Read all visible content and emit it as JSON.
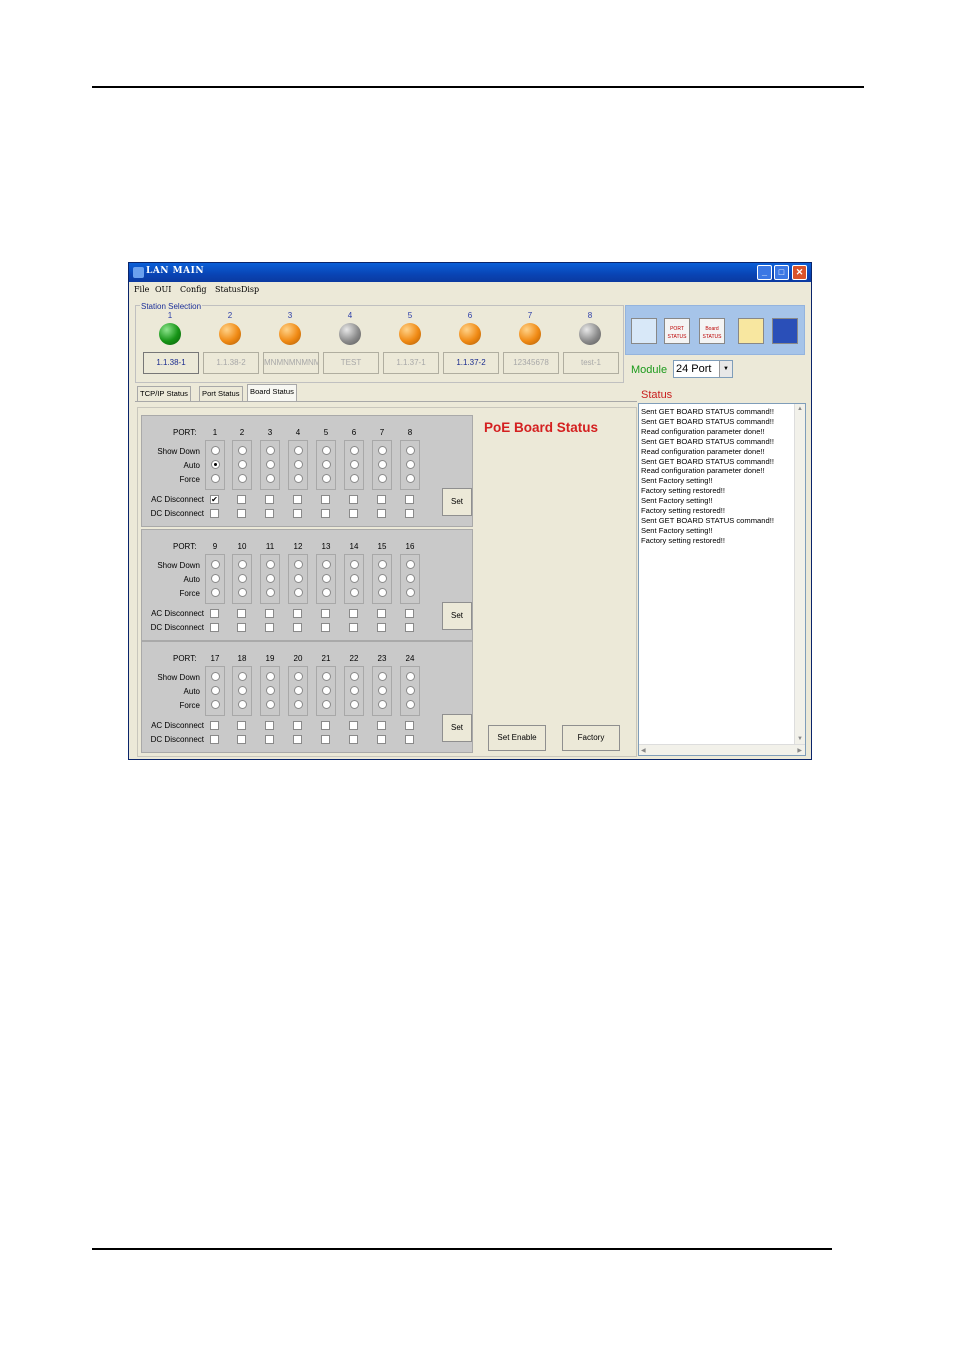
{
  "window": {
    "title": "LAN MAIN"
  },
  "menu": [
    "File",
    "OUI",
    "Config",
    "StatusDisp"
  ],
  "station_selection": {
    "label": "Station Selection",
    "stations": [
      {
        "num": "1",
        "led": "green",
        "name": "1.1.38-1",
        "active": true
      },
      {
        "num": "2",
        "led": "orange",
        "name": "1.1.38-2",
        "active": false
      },
      {
        "num": "3",
        "led": "orange",
        "name": "MNMNMNMNMN",
        "active": false
      },
      {
        "num": "4",
        "led": "gray",
        "name": "TEST",
        "active": false
      },
      {
        "num": "5",
        "led": "orange",
        "name": "1.1.37-1",
        "active": false
      },
      {
        "num": "6",
        "led": "orange",
        "name": "1.1.37-2",
        "active": true
      },
      {
        "num": "7",
        "led": "orange",
        "name": "12345678",
        "active": false
      },
      {
        "num": "8",
        "led": "gray",
        "name": "test-1",
        "active": false
      }
    ]
  },
  "toolbar": {
    "tools": [
      {
        "icon": "network-icon",
        "text": ""
      },
      {
        "icon": "port-status-icon",
        "text": "PORT STATUS"
      },
      {
        "icon": "board-status-icon",
        "text": "Board STATUS"
      },
      {
        "icon": "open-folder-icon",
        "text": ""
      },
      {
        "icon": "save-icon",
        "text": ""
      }
    ]
  },
  "module": {
    "label": "Module",
    "value": "24 Port"
  },
  "tabs": [
    "TCP/IP Status",
    "Port Status",
    "Board Status"
  ],
  "board": {
    "title": "PoE Board Status",
    "port_label": "PORT:",
    "row_labels": {
      "show_down": "Show Down",
      "auto": "Auto",
      "force": "Force",
      "ac_disconnect": "AC Disconnect",
      "dc_disconnect": "DC Disconnect"
    },
    "set_label": "Set",
    "sections": [
      {
        "ports": [
          "1",
          "2",
          "3",
          "4",
          "5",
          "6",
          "7",
          "8"
        ],
        "mode": [
          "auto",
          "",
          "",
          "",
          "",
          "",
          "",
          ""
        ],
        "ac": [
          true,
          false,
          false,
          false,
          false,
          false,
          false,
          false
        ],
        "dc": [
          false,
          false,
          false,
          false,
          false,
          false,
          false,
          false
        ]
      },
      {
        "ports": [
          "9",
          "10",
          "11",
          "12",
          "13",
          "14",
          "15",
          "16"
        ],
        "mode": [
          "",
          "",
          "",
          "",
          "",
          "",
          "",
          ""
        ],
        "ac": [
          false,
          false,
          false,
          false,
          false,
          false,
          false,
          false
        ],
        "dc": [
          false,
          false,
          false,
          false,
          false,
          false,
          false,
          false
        ]
      },
      {
        "ports": [
          "17",
          "18",
          "19",
          "20",
          "21",
          "22",
          "23",
          "24"
        ],
        "mode": [
          "",
          "",
          "",
          "",
          "",
          "",
          "",
          ""
        ],
        "ac": [
          false,
          false,
          false,
          false,
          false,
          false,
          false,
          false
        ],
        "dc": [
          false,
          false,
          false,
          false,
          false,
          false,
          false,
          false
        ]
      }
    ],
    "set_enable_label": "Set Enable",
    "factory_label": "Factory"
  },
  "status": {
    "label": "Status",
    "lines": [
      "Sent GET BOARD STATUS command!!",
      "Sent GET BOARD STATUS command!!",
      "Read configuration parameter done!!",
      "Sent GET BOARD STATUS command!!",
      "Read configuration parameter done!!",
      "Sent GET BOARD STATUS command!!",
      "Read configuration parameter done!!",
      "Sent Factory setting!!",
      "Factory setting restored!!",
      "Sent Factory setting!!",
      "Factory setting restored!!",
      "Sent GET BOARD STATUS command!!",
      "Sent Factory setting!!",
      "Factory setting restored!!"
    ]
  }
}
